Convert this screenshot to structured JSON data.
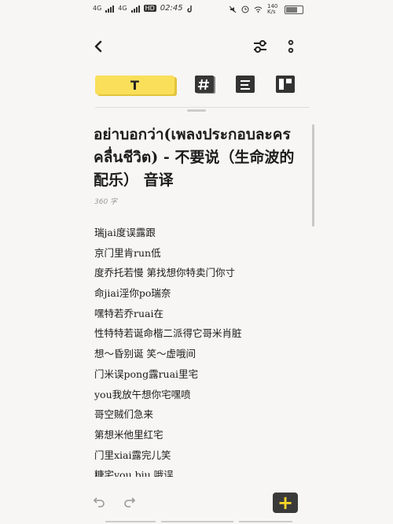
{
  "status_bar": {
    "left_network_1": "4G",
    "left_network_2": "4G",
    "hd": "HD",
    "time": "02:45",
    "right_speed": "140 K/s",
    "battery_text": "82"
  },
  "toolbar": {
    "back_icon": "chevron-left-icon",
    "settings_icon": "sliders-icon",
    "more_icon": "more-vertical-icon"
  },
  "format_bar": {
    "text_tab_label": "T",
    "tag_icon": "hash-icon",
    "list_icon": "list-icon",
    "layout_icon": "layout-icon"
  },
  "note": {
    "title": "อย่าบอกว่า(เพลงประกอบละครคลื่นชีวิต) - 不要说（生命波的配乐） 音译",
    "word_count": "360 字",
    "lines": [
      "瑞jai度误露跟",
      "京门里肯run低",
      "度乔托若慢 第找想你特卖门你寸",
      "命jiai淫你po瑞奈",
      "嘿特若乔ruai在",
      "性特特若诞命楷二派得它哥米肖脏",
      "想～昏别诞 笑～虚哦间",
      "门米误pong露ruai里宅",
      "you我放午想你宅嘿喷",
      "哥空贼们急来",
      "第想米他里红宅",
      "门里xiai露完儿笑",
      "糖宅you biu 哦误"
    ]
  },
  "bottom": {
    "undo_icon": "undo-icon",
    "redo_icon": "redo-icon",
    "add_label": "+"
  }
}
